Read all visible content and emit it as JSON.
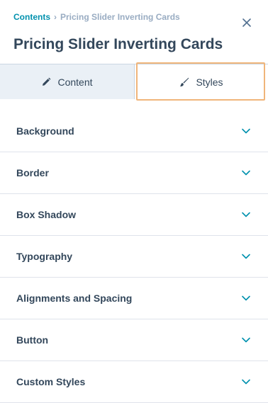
{
  "breadcrumb": {
    "root": "Contents",
    "separator": "›",
    "current": "Pricing Slider Inverting Cards"
  },
  "header": {
    "title": "Pricing Slider Inverting Cards",
    "close_icon": "close-icon"
  },
  "tabs": [
    {
      "label": "Content",
      "icon": "pencil-icon",
      "active": false
    },
    {
      "label": "Styles",
      "icon": "brush-icon",
      "active": true
    }
  ],
  "sections": [
    {
      "label": "Background"
    },
    {
      "label": "Border"
    },
    {
      "label": "Box Shadow"
    },
    {
      "label": "Typography"
    },
    {
      "label": "Alignments and Spacing"
    },
    {
      "label": "Button"
    },
    {
      "label": "Custom Styles"
    }
  ],
  "colors": {
    "link": "#0091ae",
    "text": "#33475b",
    "muted": "#99acc2",
    "highlight": "#f0b57a"
  }
}
